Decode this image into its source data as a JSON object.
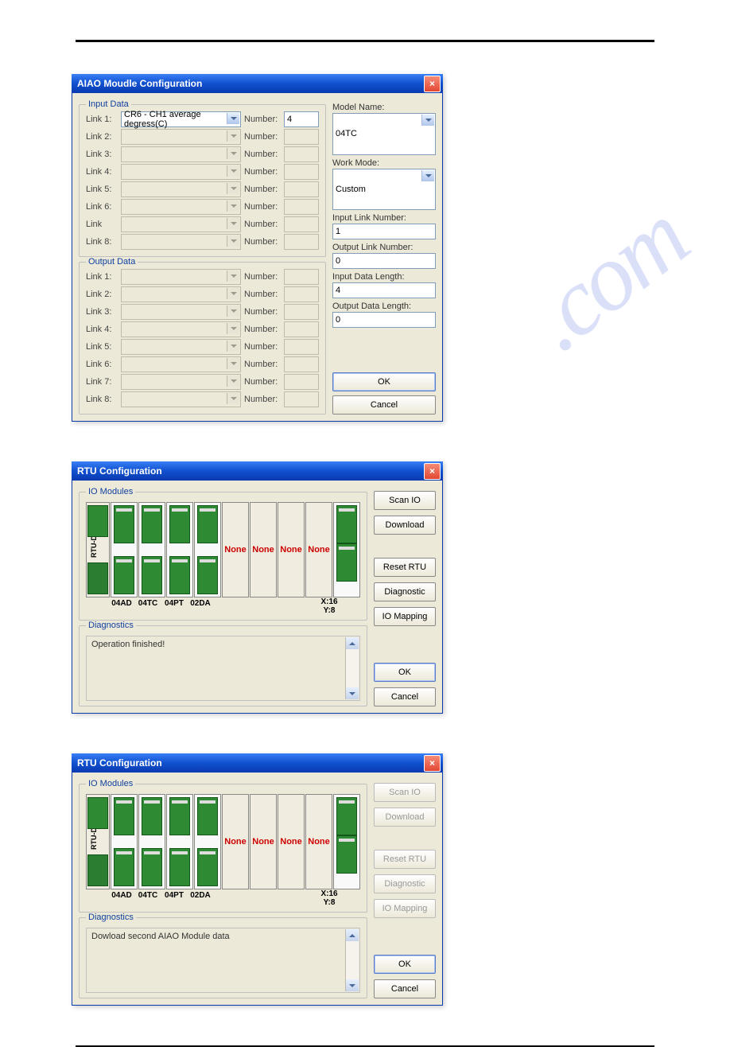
{
  "dlg1": {
    "title": "AIAO Moudle Configuration",
    "inputLegend": "Input Data",
    "outputLegend": "Output Data",
    "numberLabel": "Number:",
    "inputLinks": [
      {
        "label": "Link 1:",
        "value": "CR6 - CH1 average degress(C)",
        "num": "4",
        "enabled": true
      },
      {
        "label": "Link 2:",
        "value": "",
        "num": "",
        "enabled": false
      },
      {
        "label": "Link 3:",
        "value": "",
        "num": "",
        "enabled": false
      },
      {
        "label": "Link 4:",
        "value": "",
        "num": "",
        "enabled": false
      },
      {
        "label": "Link 5:",
        "value": "",
        "num": "",
        "enabled": false
      },
      {
        "label": "Link 6:",
        "value": "",
        "num": "",
        "enabled": false
      },
      {
        "label": "Link",
        "value": "",
        "num": "",
        "enabled": false
      },
      {
        "label": "Link 8:",
        "value": "",
        "num": "",
        "enabled": false
      }
    ],
    "outputLinks": [
      {
        "label": "Link 1:"
      },
      {
        "label": "Link 2:"
      },
      {
        "label": "Link 3:"
      },
      {
        "label": "Link 4:"
      },
      {
        "label": "Link 5:"
      },
      {
        "label": "Link 6:"
      },
      {
        "label": "Link 7:"
      },
      {
        "label": "Link 8:"
      }
    ],
    "right": {
      "modelNameLabel": "Model Name:",
      "modelName": "04TC",
      "workModeLabel": "Work Mode:",
      "workMode": "Custom",
      "inputLinkNumLabel": "Input Link Number:",
      "inputLinkNum": "1",
      "outputLinkNumLabel": "Output Link Number:",
      "outputLinkNum": "0",
      "inputDataLenLabel": "Input Data Length:",
      "inputDataLen": "4",
      "outputDataLenLabel": "Output Data Length:",
      "outputDataLen": "0"
    },
    "ok": "OK",
    "cancel": "Cancel"
  },
  "dlg2": {
    "title": "RTU Configuration",
    "ioLegend": "IO Modules",
    "diagLegend": "Diagnostics",
    "diagText": "Operation finished!",
    "modules": [
      "04AD",
      "04TC",
      "04PT",
      "02DA"
    ],
    "noneLabel": "None",
    "xy": "X:16\nY:8",
    "buttons": {
      "scan": "Scan IO",
      "download": "Download",
      "reset": "Reset RTU",
      "diag": "Diagnostic",
      "map": "IO Mapping"
    },
    "ok": "OK",
    "cancel": "Cancel",
    "buttonsEnabled": true
  },
  "dlg3": {
    "title": "RTU Configuration",
    "ioLegend": "IO Modules",
    "diagLegend": "Diagnostics",
    "diagText": "Dowload second AIAO Module data",
    "modules": [
      "04AD",
      "04TC",
      "04PT",
      "02DA"
    ],
    "noneLabel": "None",
    "xy": "X:16\nY:8",
    "buttons": {
      "scan": "Scan IO",
      "download": "Download",
      "reset": "Reset RTU",
      "diag": "Diagnostic",
      "map": "IO Mapping"
    },
    "ok": "OK",
    "cancel": "Cancel",
    "buttonsEnabled": false
  }
}
